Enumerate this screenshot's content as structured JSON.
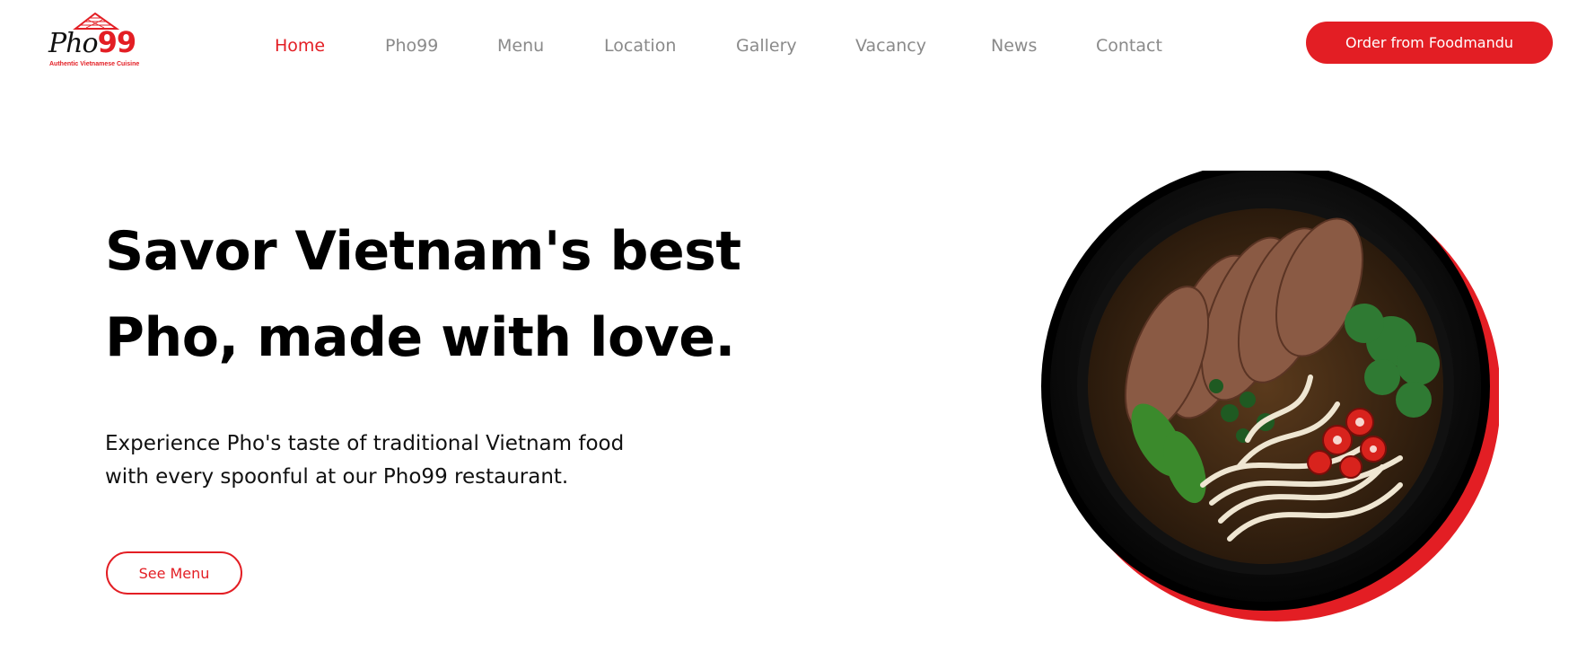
{
  "brand": {
    "logo_name": "Pho",
    "logo_number": "99",
    "tagline": "Authentic Vietnamese Cuisine"
  },
  "nav": {
    "items": [
      {
        "label": "Home",
        "active": true
      },
      {
        "label": "Pho99",
        "active": false
      },
      {
        "label": "Menu",
        "active": false
      },
      {
        "label": "Location",
        "active": false
      },
      {
        "label": "Gallery",
        "active": false
      },
      {
        "label": "Vacancy",
        "active": false
      },
      {
        "label": "News",
        "active": false
      },
      {
        "label": "Contact",
        "active": false
      }
    ]
  },
  "header": {
    "order_button": "Order from Foodmandu"
  },
  "hero": {
    "title_line1": "Savor Vietnam's best",
    "title_line2": "Pho, made with love.",
    "description_line1": "Experience Pho's taste of traditional Vietnam food",
    "description_line2": "with every spoonful at our Pho99 restaurant.",
    "cta_button": "See Menu"
  },
  "colors": {
    "accent": "#e31e24",
    "nav_text": "#8a8a8a",
    "text": "#000000"
  },
  "icons": {
    "logo": "pho99-roof-logo",
    "hero_image": "pho-bowl-image"
  }
}
